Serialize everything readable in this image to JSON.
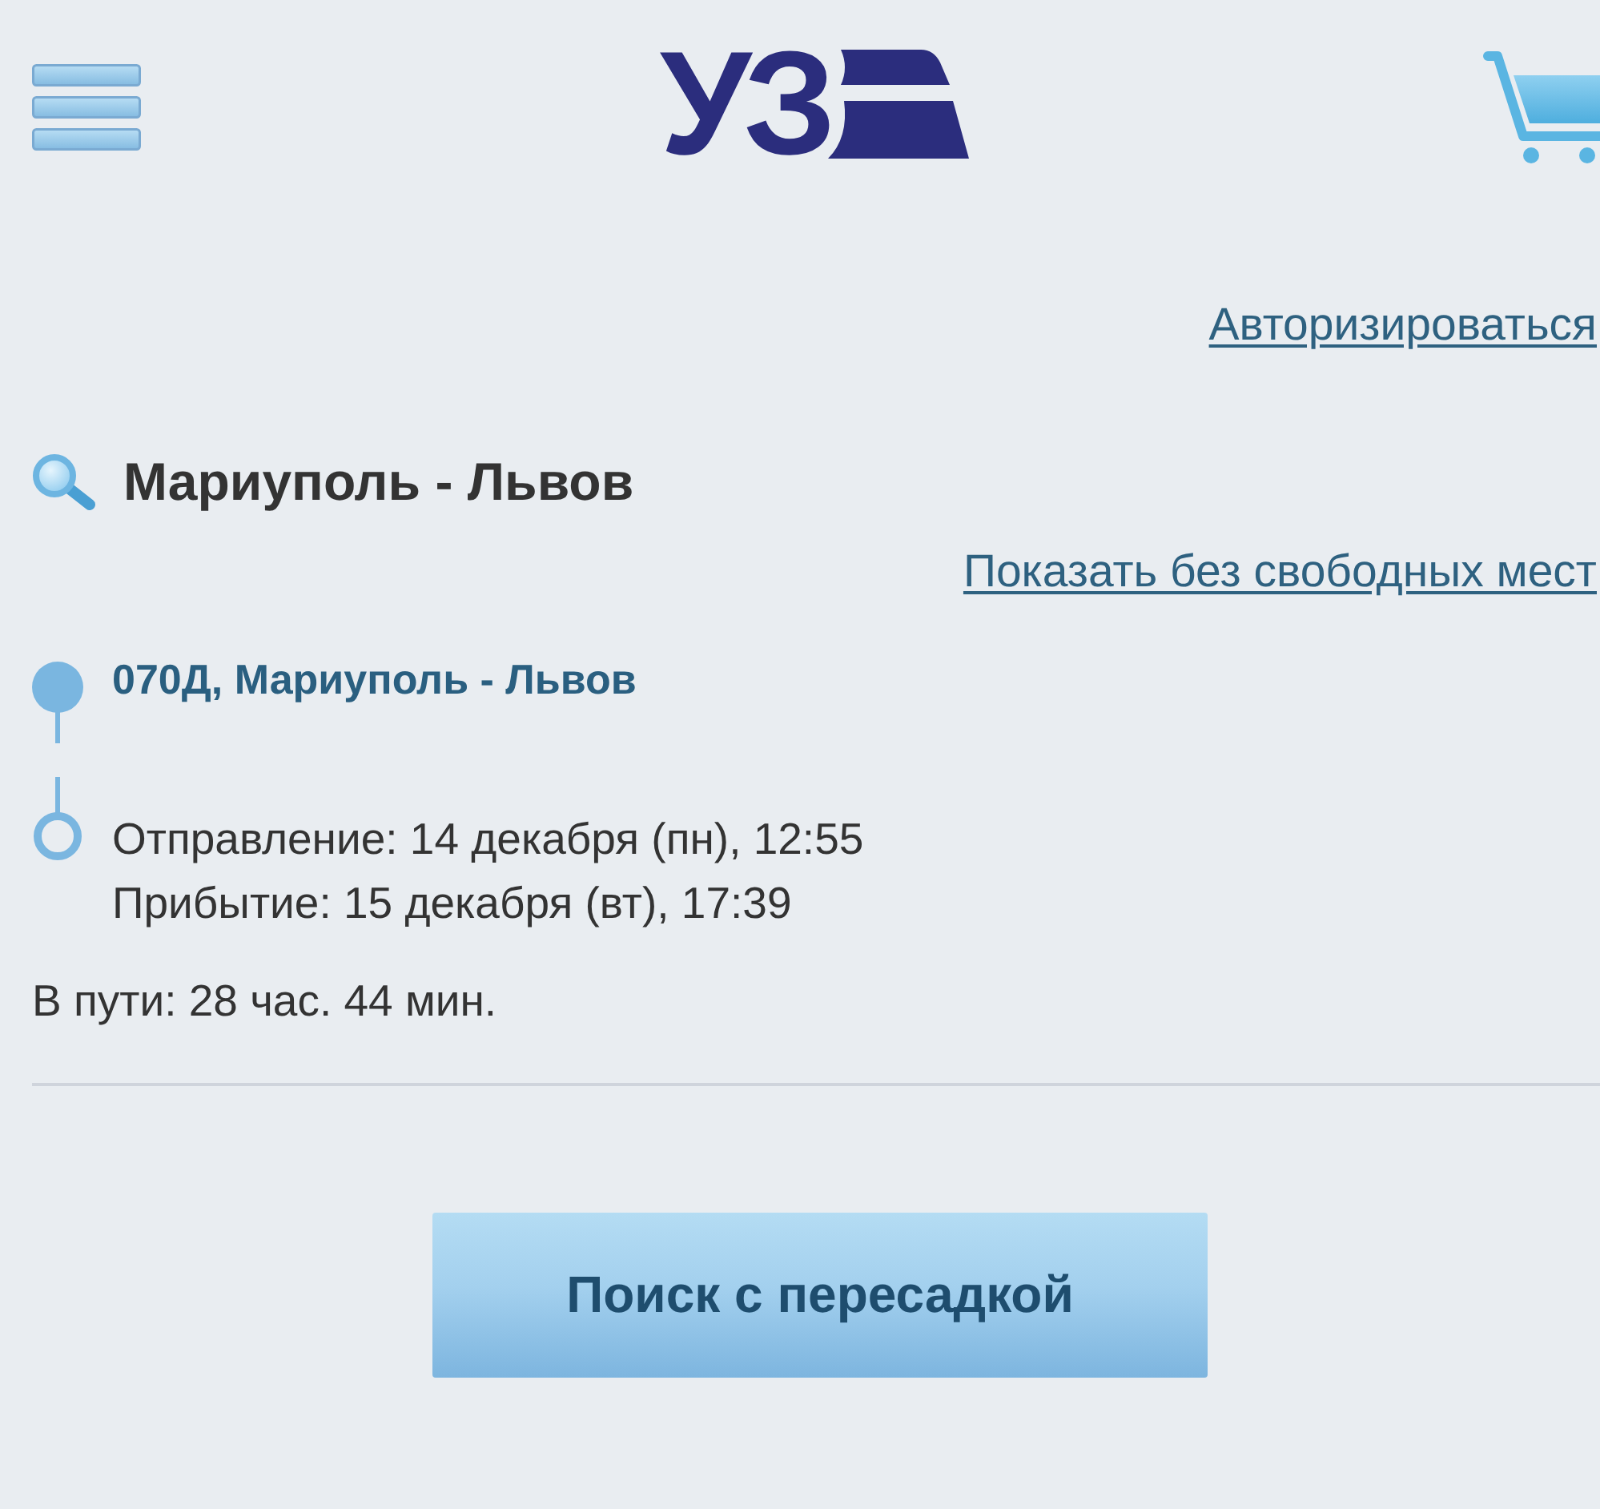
{
  "header": {
    "logo_text": "УЗ"
  },
  "login_link": "Авторизироваться",
  "route_title": "Мариуполь - Львов",
  "show_unavailable_link": "Показать без свободных мест",
  "trains": [
    {
      "name": "070Д, Мариуполь - Львов",
      "departure": "Отправление: 14 декабря (пн), 12:55",
      "arrival": "Прибытие: 15 декабря (вт), 17:39",
      "duration": "В пути: 28 час. 44 мин."
    }
  ],
  "buttons": [
    {
      "label": "Поиск с пересадкой"
    }
  ]
}
